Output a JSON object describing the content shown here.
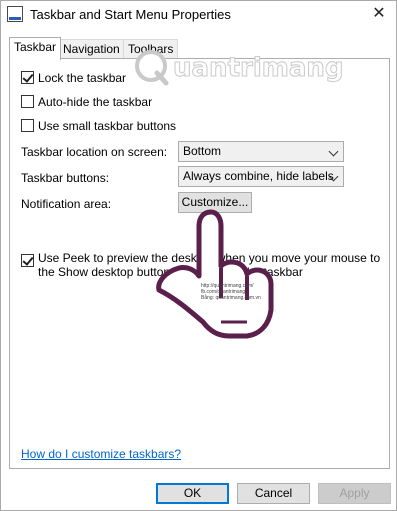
{
  "window": {
    "title": "Taskbar and Start Menu Properties",
    "close_glyph": "✕"
  },
  "tabs": [
    {
      "label": "Taskbar",
      "active": true
    },
    {
      "label": "Navigation",
      "active": false
    },
    {
      "label": "Toolbars",
      "active": false
    }
  ],
  "options": {
    "lock_taskbar": {
      "label": "Lock the taskbar",
      "checked": true
    },
    "auto_hide": {
      "label": "Auto-hide the taskbar",
      "checked": false
    },
    "small_buttons": {
      "label": "Use small taskbar buttons",
      "checked": false
    }
  },
  "fields": {
    "location": {
      "label": "Taskbar location on screen:",
      "value": "Bottom"
    },
    "buttons": {
      "label": "Taskbar buttons:",
      "value": "Always combine, hide labels"
    },
    "notification": {
      "label": "Notification area:",
      "button": "Customize..."
    }
  },
  "peek": {
    "checked": true,
    "text": "Use Peek to preview the desktop when you move your mouse to the Show desktop button at the end of the taskbar"
  },
  "help_link": "How do I customize taskbars?",
  "footer": {
    "ok": "OK",
    "cancel": "Cancel",
    "apply": "Apply"
  },
  "watermark": {
    "text": "uantrimang",
    "caption_1": "http://quantrimang.com/",
    "caption_2": "fb.com/quantrimang",
    "caption_3": "Bằng: quantrimang.com.vn"
  },
  "colors": {
    "link": "#0066cc",
    "accent": "#0078d7",
    "hand_outline": "#5a1f4a"
  }
}
